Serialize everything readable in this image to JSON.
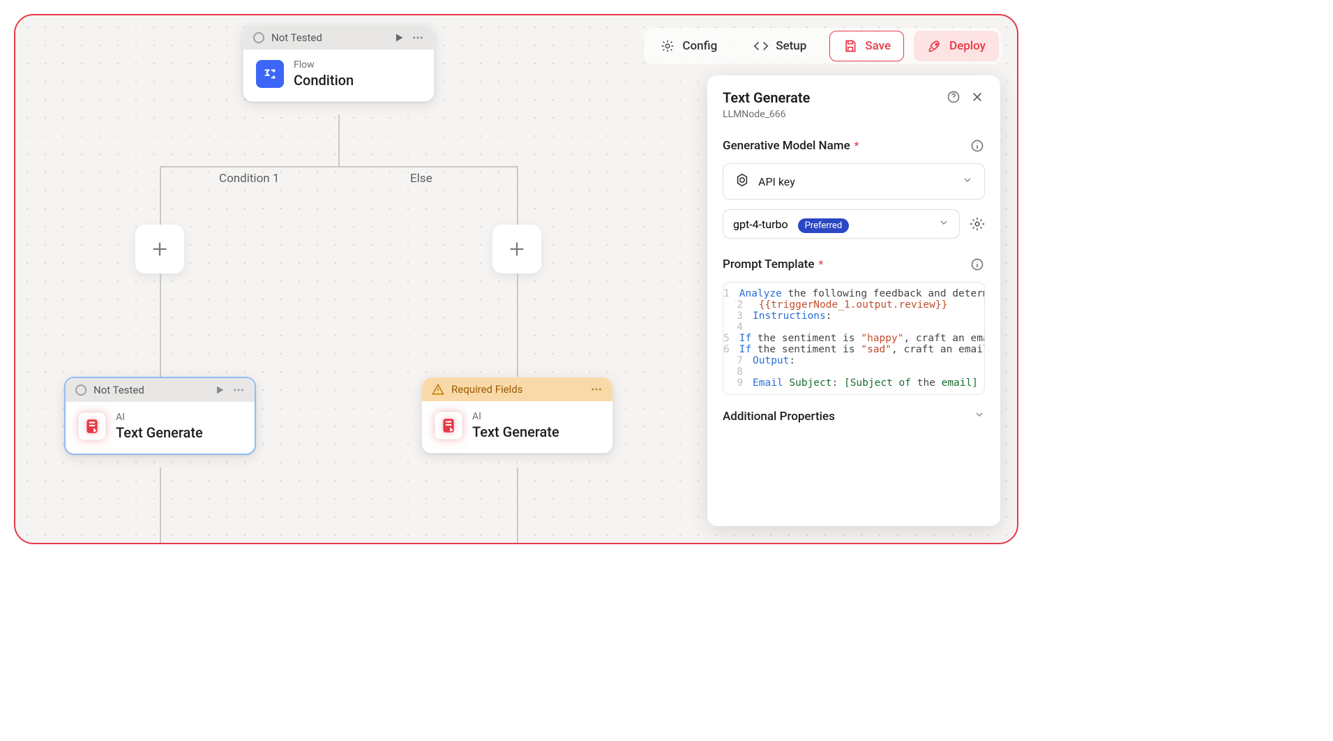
{
  "toolbar": {
    "config": "Config",
    "setup": "Setup",
    "save": "Save",
    "deploy": "Deploy"
  },
  "nodes": {
    "condition": {
      "status": "Not Tested",
      "category": "Flow",
      "title": "Condition"
    },
    "branch1_label": "Condition 1",
    "branch2_label": "Else",
    "textgen1": {
      "status": "Not Tested",
      "category": "AI",
      "title": "Text Generate"
    },
    "textgen2": {
      "status": "Required Fields",
      "category": "AI",
      "title": "Text Generate"
    }
  },
  "panel": {
    "title": "Text Generate",
    "subtitle": "LLMNode_666",
    "model_label": "Generative Model Name",
    "api_key_label": "API key",
    "model_value": "gpt-4-turbo",
    "model_badge": "Preferred",
    "prompt_label": "Prompt Template",
    "additional": "Additional Properties",
    "code": {
      "l1_a": "Analyze",
      "l1_b": " the following feedback and determi",
      "l2": "{{triggerNode_1.output.review}}",
      "l3_a": "Instructions",
      "l3_b": ":",
      "l4": "",
      "l5_a": "If",
      "l5_b": " the sentiment is ",
      "l5_c": "\"happy\"",
      "l5_d": ", craft an emai",
      "l6_a": "If",
      "l6_b": " the sentiment is ",
      "l6_c": "\"sad\"",
      "l6_d": ", craft an email",
      "l7_a": "Output",
      "l7_b": ":",
      "l8": "",
      "l9_a": "Email ",
      "l9_b": "Subject",
      "l9_c": ": ",
      "l9_d": "[Subject of",
      "l9_e": " the ",
      "l9_f": "email]"
    }
  }
}
